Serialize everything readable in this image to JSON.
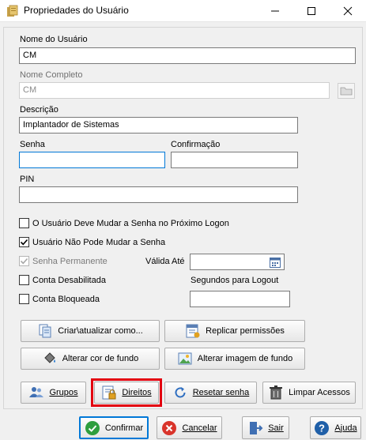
{
  "window": {
    "title": "Propriedades do Usuário",
    "minimize_glyph": "—",
    "maximize_glyph": "☐",
    "close_glyph": "✕"
  },
  "form": {
    "username_label": "Nome do Usuário",
    "username_value": "CM",
    "fullname_label": "Nome Completo",
    "fullname_value": "CM",
    "description_label": "Descrição",
    "description_value": "Implantador de Sistemas",
    "password_label": "Senha",
    "password_value": "",
    "confirm_label": "Confirmação",
    "confirm_value": "",
    "pin_label": "PIN",
    "pin_value": ""
  },
  "options": {
    "must_change": {
      "label": "O Usuário Deve Mudar a Senha no Próximo Logon",
      "checked": false
    },
    "cannot_change": {
      "label": "Usuário Não Pode Mudar a Senha",
      "checked": true
    },
    "permanent": {
      "label": "Senha Permanente",
      "checked": true,
      "disabled": true
    },
    "disabled_account": {
      "label": "Conta Desabilitada",
      "checked": false
    },
    "locked_account": {
      "label": "Conta Bloqueada",
      "checked": false
    },
    "valid_until_label": "Válida Até",
    "valid_until_value": "",
    "logout_seconds_label": "Segundos para Logout",
    "logout_seconds_value": ""
  },
  "actions": {
    "create_update": "Criar\\atualizar como...",
    "replicate": "Replicar permissões",
    "bg_color": "Alterar cor de fundo",
    "bg_image": "Alterar imagem de fundo",
    "groups": "Grupos",
    "rights": "Direitos",
    "reset_password": "Resetar senha",
    "clear_access": "Limpar Acessos"
  },
  "footer": {
    "confirm": "Confirmar",
    "cancel": "Cancelar",
    "exit": "Sair",
    "help": "Ajuda"
  },
  "colors": {
    "accent": "#0078d7",
    "highlight": "#e3000f",
    "confirm_green": "#2e9e3e",
    "cancel_red": "#d9342b",
    "help_blue": "#1f5fa8"
  }
}
